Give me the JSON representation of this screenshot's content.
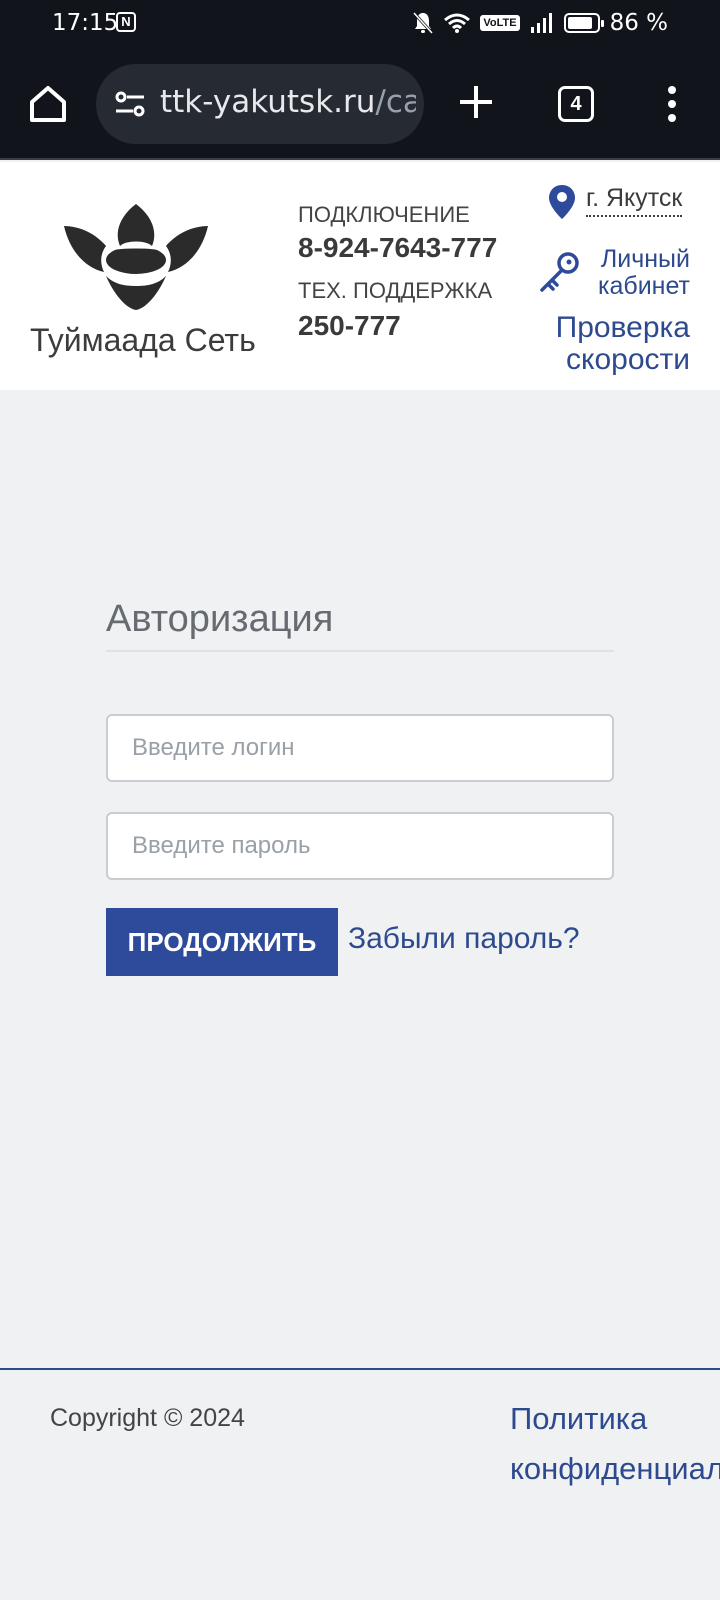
{
  "status_bar": {
    "time": "17:15",
    "battery_percent": "86 %",
    "battery_level": 0.86,
    "network_label": "VoLTE"
  },
  "browser": {
    "url_main": "ttk-yakutsk.ru",
    "url_rest": "/ca",
    "tab_count": "4"
  },
  "header": {
    "brand": "Туймаада Сеть",
    "connection_label": "ПОДКЛЮЧЕНИЕ",
    "connection_phone": "8-924-7643-777",
    "support_label": "ТЕХ. ПОДДЕРЖКА",
    "support_phone": "250-777",
    "city": "г. Якутск",
    "cabinet_line1": "Личный",
    "cabinet_line2": "кабинет",
    "speed_line1": "Проверка",
    "speed_line2": "скорости"
  },
  "auth": {
    "title": "Авторизация",
    "login_placeholder": "Введите логин",
    "password_placeholder": "Введите пароль",
    "submit_label": "ПРОДОЛЖИТЬ",
    "forgot_label": "Забыли пароль?"
  },
  "footer": {
    "copyright": "Copyright © 2024",
    "policy_line1": "Политика",
    "policy_line2": "конфиденциальности"
  },
  "colors": {
    "accent": "#2e4a9a",
    "link": "#2e4a8f",
    "background": "#f0f1f3",
    "browser_chrome": "#11141b"
  }
}
